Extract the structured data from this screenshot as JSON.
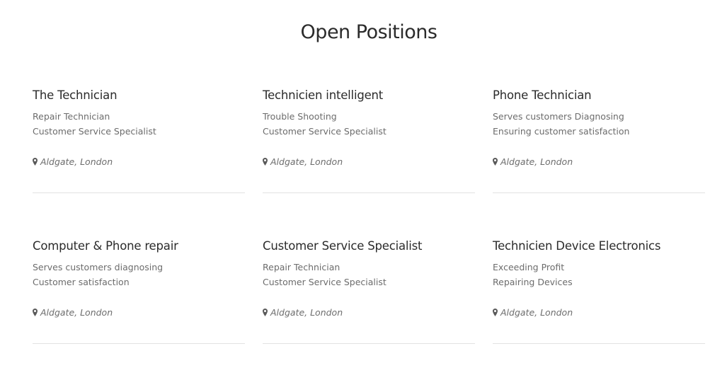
{
  "section": {
    "title": "Open Positions"
  },
  "positions": [
    {
      "title": "The Technician",
      "lines": [
        "Repair Technician",
        "Customer Service Specialist"
      ],
      "location": "Aldgate, London"
    },
    {
      "title": "Technicien intelligent",
      "lines": [
        "Trouble Shooting",
        "Customer Service Specialist"
      ],
      "location": "Aldgate, London"
    },
    {
      "title": "Phone Technician",
      "lines": [
        "Serves customers Diagnosing",
        "Ensuring customer satisfaction"
      ],
      "location": "Aldgate, London"
    },
    {
      "title": "Computer & Phone repair",
      "lines": [
        "Serves customers diagnosing",
        "Customer satisfaction"
      ],
      "location": "Aldgate, London"
    },
    {
      "title": "Customer Service Specialist",
      "lines": [
        "Repair Technician",
        "Customer Service Specialist"
      ],
      "location": "Aldgate, London"
    },
    {
      "title": "Technicien Device Electronics",
      "lines": [
        "Exceeding Profit",
        "Repairing Devices"
      ],
      "location": "Aldgate, London"
    }
  ],
  "icons": {
    "location": "map-pin-icon"
  },
  "colors": {
    "heading": "#2b2b2b",
    "text": "#6c6c6c",
    "divider": "#e2e2e2"
  }
}
